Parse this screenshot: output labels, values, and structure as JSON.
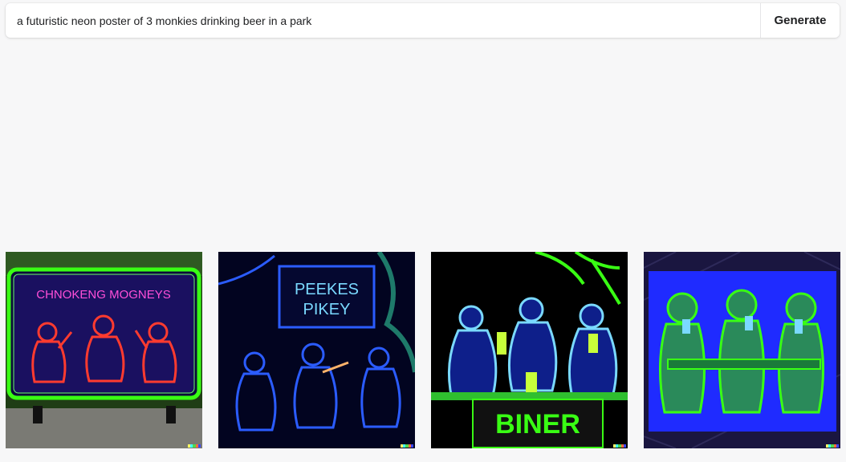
{
  "prompt": {
    "value": "a futuristic neon poster of 3 monkies drinking beer in a park",
    "placeholder": ""
  },
  "generate_label": "Generate",
  "results": [
    {
      "sign_text_1": "CHNOKENG MOGNEYS",
      "sign_text_2": ""
    },
    {
      "sign_text_1": "PEEKES",
      "sign_text_2": "PIKEY"
    },
    {
      "sign_text_1": "BINER",
      "sign_text_2": ""
    },
    {
      "sign_text_1": "",
      "sign_text_2": ""
    }
  ],
  "colors": {
    "background": "#f7f7f8",
    "neon_red": "#ff3b2f",
    "neon_pink": "#ff4fd8",
    "neon_green": "#39ff14",
    "neon_blue": "#2b5cff",
    "neon_cyan": "#7ad9ff"
  },
  "badge_colors": [
    "#ffff66",
    "#42ffff",
    "#51da4c",
    "#ff6e3c",
    "#3c46ff"
  ]
}
